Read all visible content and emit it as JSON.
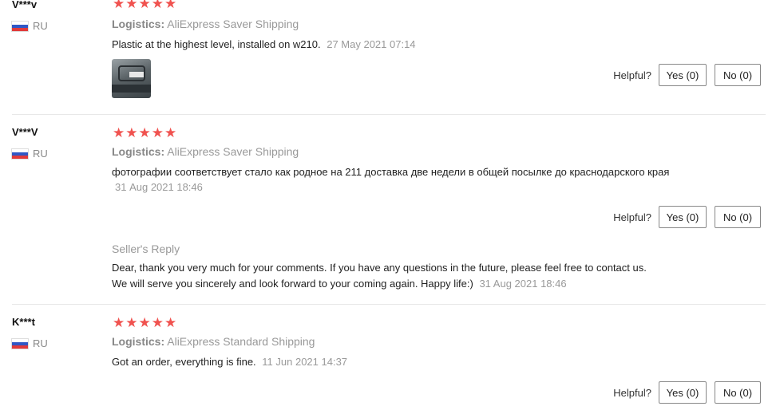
{
  "labels": {
    "logistics": "Logistics:",
    "helpful": "Helpful?",
    "seller_reply": "Seller's Reply"
  },
  "reviews": [
    {
      "user": "V***v",
      "country": "RU",
      "rating": 5,
      "stars": "★★★★★",
      "logistics": "AliExpress Saver Shipping",
      "text": "Plastic at the highest level, installed on w210.",
      "date": "27 May 2021 07:14",
      "yes": "Yes (0)",
      "no": "No (0)"
    },
    {
      "user": "V***V",
      "country": "RU",
      "rating": 5,
      "stars": "★★★★★",
      "logistics": "AliExpress Saver Shipping",
      "text": "фотографии соответствует стало как родное на 211 доставка две недели в общей посылке до краснодарского края",
      "date": "31 Aug 2021 18:46",
      "yes": "Yes (0)",
      "no": "No (0)",
      "reply": {
        "text": "Dear, thank you very much for your comments. If you have any questions in the future, please feel free to contact us. We will serve you sincerely and look forward to your coming again. Happy life:)",
        "date": "31 Aug 2021 18:46"
      }
    },
    {
      "user": "K***t",
      "country": "RU",
      "rating": 5,
      "stars": "★★★★★",
      "logistics": "AliExpress Standard Shipping",
      "text": "Got an order, everything is fine.",
      "date": "11 Jun 2021 14:37",
      "yes": "Yes (0)",
      "no": "No (0)"
    }
  ],
  "colors": {
    "star": "#f0524f",
    "muted": "#999999",
    "divider": "#e8e8e8"
  }
}
